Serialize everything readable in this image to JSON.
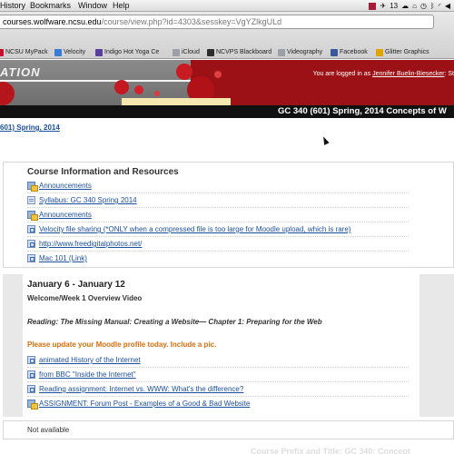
{
  "menubar": {
    "items": [
      "History",
      "Bookmarks",
      "Window",
      "Help"
    ],
    "battery": "13"
  },
  "browser": {
    "url_host": "courses.wolfware.ncsu.edu",
    "url_path": "/course/view.php?id=4303&sesskey=VgYZlkgULd",
    "bookmarks": [
      {
        "label": "NCSU MyPack",
        "color": "#c8102e"
      },
      {
        "label": "Velocity",
        "color": "#3a7bd5"
      },
      {
        "label": "Indigo Hot Yoga Ce",
        "color": "#5b3ca0"
      },
      {
        "label": "iCloud",
        "color": "#9aa0a6"
      },
      {
        "label": "NCVPS Blackboard",
        "color": "#2d2d2d"
      },
      {
        "label": "Videography",
        "color": "#9aa0a6"
      },
      {
        "label": "Facebook",
        "color": "#3b5998"
      },
      {
        "label": "Glitter Graphics",
        "color": "#e0a400"
      }
    ]
  },
  "banner": {
    "brand_fragment": "ATION",
    "logged_in_prefix": "You are logged in as",
    "user_name": "Jennifer Buelin-Biesecker",
    "logged_in_suffix": ": St"
  },
  "course_title": "GC 340 (601) Spring, 2014 Concepts of W",
  "breadcrumb": "601) Spring, 2014",
  "section_info": {
    "title": "Course Information and Resources",
    "items": [
      {
        "label": "Announcements",
        "icon": "forum-icon"
      },
      {
        "label": "Syllabus: GC 340 Spring 2014",
        "icon": "file-icon"
      },
      {
        "label": "Announcements",
        "icon": "forum-icon"
      },
      {
        "label": "Velocity file sharing (*ONLY when a compressed file is too large for Moodle upload, which is rare)",
        "icon": "link-icon"
      },
      {
        "label": "http://www.freedigitalphotos.net/",
        "icon": "link-icon"
      },
      {
        "label": "Mac 101 (Link)",
        "icon": "link-icon"
      }
    ]
  },
  "week1": {
    "title": "January 6 - January 12",
    "subtitle": "Welcome/Week 1 Overview Video",
    "reading": "Reading:  The Missing Manual: Creating a Website— Chapter 1: Preparing for the Web",
    "notice": "Please update your Moodle profile today. Include a pic.",
    "items": [
      {
        "label": "animated History of the Internet",
        "icon": "link-icon"
      },
      {
        "label": "from BBC \"Inside the Internet\"",
        "icon": "link-icon"
      },
      {
        "label": "Reading assignment: Internet vs. WWW: What's the difference?",
        "icon": "link-icon"
      },
      {
        "label": "ASSIGNMENT: Forum Post - Examples of a Good & Bad Website",
        "icon": "forum-icon"
      }
    ]
  },
  "not_available": "Not available",
  "footer_fragment": "Course Prefix and Title:   GC 340: Concept"
}
